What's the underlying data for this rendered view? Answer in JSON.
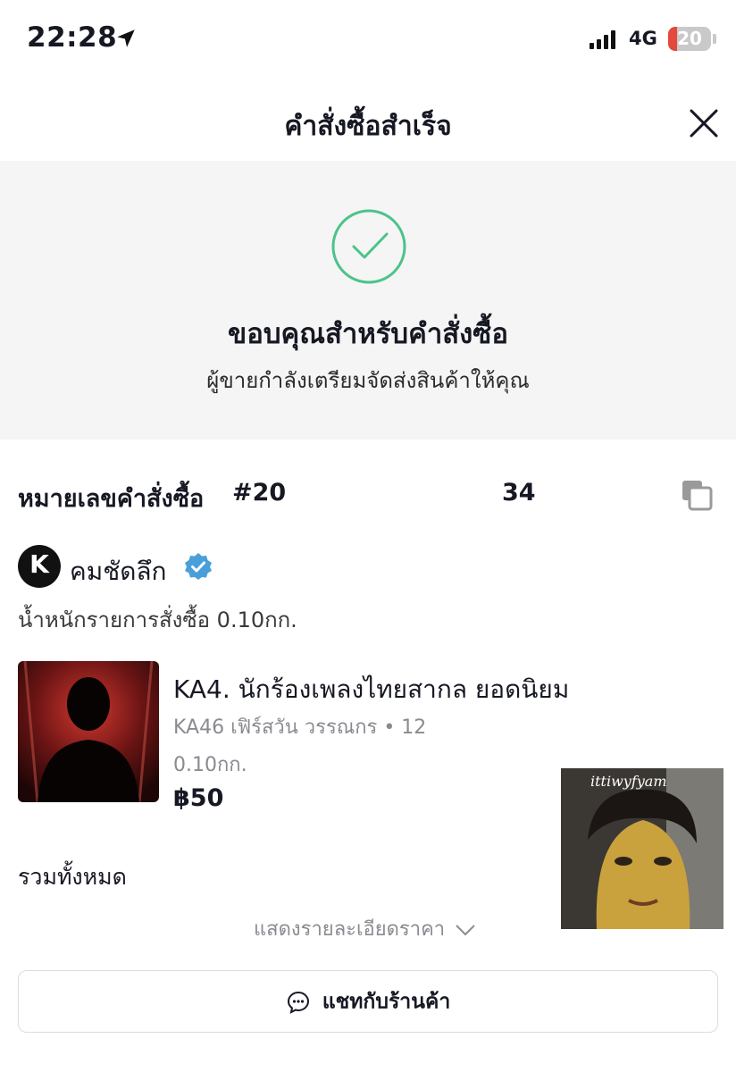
{
  "status_bar": {
    "time": "22:28",
    "network": "4G",
    "battery": "20",
    "battery_level": 0.2,
    "icons": [
      "location-arrow-icon",
      "signal-icon"
    ]
  },
  "header": {
    "title": "คำสั่งซื้อสำเร็จ",
    "close_icon": "close-icon"
  },
  "banner": {
    "icon": "check-circle-icon",
    "title": "ขอบคุณสำหรับคำสั่งซื้อ",
    "subtitle": "ผู้ขายกำลังเตรียมจัดส่งสินค้าให้คุณ",
    "accent": "#4cc38a"
  },
  "order": {
    "label": "หมายเลขคำสั่งซื้อ",
    "number_start": "#20",
    "number_end": "34"
  },
  "shop": {
    "logo_letter": "K",
    "name": "คมชัดลึก",
    "verified_color": "#4a9fd8",
    "weight_text": "น้ำหนักรายการสั่งซื้อ 0.10กก."
  },
  "product": {
    "title": "KA4. นักร้องเพลงไทยสากล ยอดนิยม",
    "variant": "KA46 เฟิร์สวัน วรรณกร • 12",
    "weight": "0.10กก.",
    "price": "฿50"
  },
  "overlay": {
    "watermark": "ittiwyfyam"
  },
  "summary": {
    "total_label": "รวมทั้งหมด",
    "price_detail": "แสดงรายละเอียดราคา"
  },
  "chat_button": {
    "label": "แชทกับร้านค้า"
  }
}
